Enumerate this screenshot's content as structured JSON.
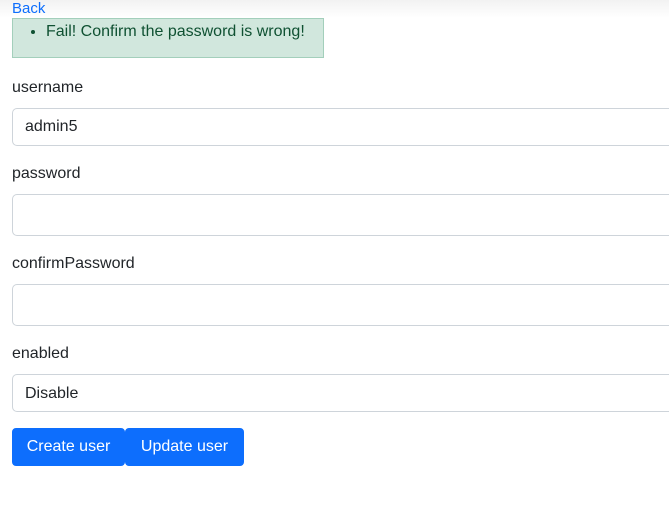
{
  "nav": {
    "back_label": "Back"
  },
  "alert": {
    "message": "Fail! Confirm the password is wrong!"
  },
  "form": {
    "username": {
      "label": "username",
      "value": "admin5"
    },
    "password": {
      "label": "password",
      "value": ""
    },
    "confirm_password": {
      "label": "confirmPassword",
      "value": ""
    },
    "enabled": {
      "label": "enabled",
      "selected": "Disable"
    }
  },
  "buttons": {
    "create_label": "Create user",
    "update_label": "Update user"
  },
  "colors": {
    "primary": "#0d6efd",
    "alert_bg": "#d1e7dd",
    "alert_text": "#0f5132"
  }
}
